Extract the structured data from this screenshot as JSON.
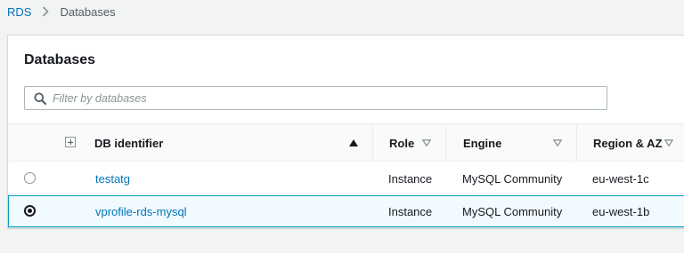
{
  "breadcrumb": {
    "root": "RDS",
    "current": "Databases"
  },
  "panel": {
    "title": "Databases"
  },
  "search": {
    "placeholder": "Filter by databases",
    "value": ""
  },
  "table": {
    "columns": {
      "identifier": "DB identifier",
      "role": "Role",
      "engine": "Engine",
      "region": "Region & AZ"
    },
    "rows": [
      {
        "identifier": "testatg",
        "role": "Instance",
        "engine": "MySQL Community",
        "region": "eu-west-1c",
        "selected": false
      },
      {
        "identifier": "vprofile-rds-mysql",
        "role": "Instance",
        "engine": "MySQL Community",
        "region": "eu-west-1b",
        "selected": true
      }
    ]
  },
  "colors": {
    "link": "#0073bb",
    "selected_border": "#00a1c9",
    "selected_bg": "#f1faff"
  }
}
